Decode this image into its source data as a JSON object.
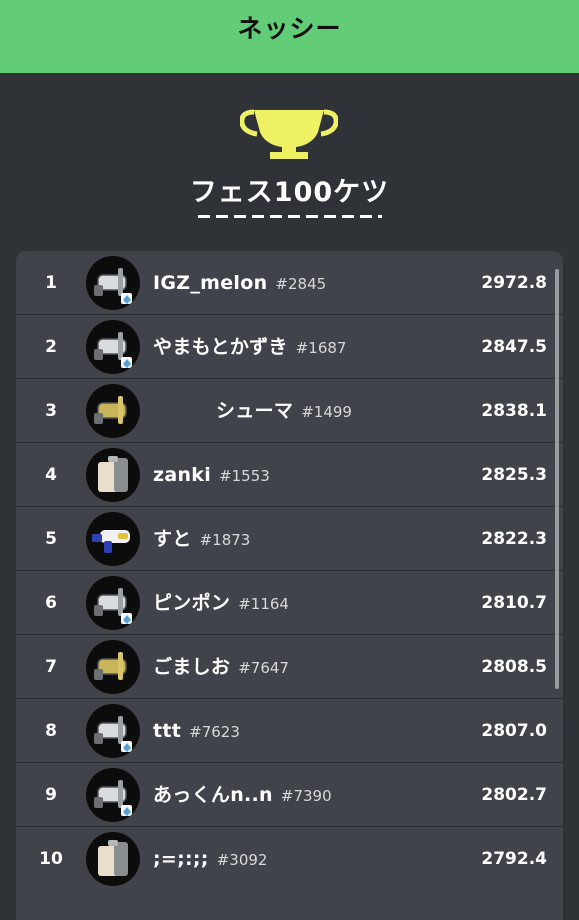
{
  "header": {
    "title": "ネッシー"
  },
  "ranking": {
    "title": "フェス100ケツ",
    "icon": "trophy-icon",
    "trophy_color": "#eef163"
  },
  "theme": {
    "header_bg": "#63cc77",
    "page_bg": "#2f3237",
    "panel_bg": "#404349"
  },
  "players": [
    {
      "rank": "1",
      "name": "IGZ_melon",
      "id": "#2845",
      "score": "2972.8",
      "weapon_icon": "brush-weapon-icon"
    },
    {
      "rank": "2",
      "name": "やまもとかずき",
      "id": "#1687",
      "score": "2847.5",
      "weapon_icon": "brush-weapon-icon"
    },
    {
      "rank": "3",
      "name": "シューマ",
      "id": "#1499",
      "score": "2838.1",
      "weapon_icon": "brush-weapon-gold-icon"
    },
    {
      "rank": "4",
      "name": "zanki",
      "id": "#1553",
      "score": "2825.3",
      "weapon_icon": "splatling-weapon-icon"
    },
    {
      "rank": "5",
      "name": "すと",
      "id": "#1873",
      "score": "2822.3",
      "weapon_icon": "blaster-weapon-icon"
    },
    {
      "rank": "6",
      "name": "ピンポン",
      "id": "#1164",
      "score": "2810.7",
      "weapon_icon": "brush-weapon-icon"
    },
    {
      "rank": "7",
      "name": "ごましお",
      "id": "#7647",
      "score": "2808.5",
      "weapon_icon": "brush-weapon-gold-icon"
    },
    {
      "rank": "8",
      "name": "ttt",
      "id": "#7623",
      "score": "2807.0",
      "weapon_icon": "brush-weapon-icon"
    },
    {
      "rank": "9",
      "name": "あっくんn..n",
      "id": "#7390",
      "score": "2802.7",
      "weapon_icon": "brush-weapon-icon"
    },
    {
      "rank": "10",
      "name": ";=;:;;",
      "id": "#3092",
      "score": "2792.4",
      "weapon_icon": "splatling-weapon-icon"
    }
  ]
}
